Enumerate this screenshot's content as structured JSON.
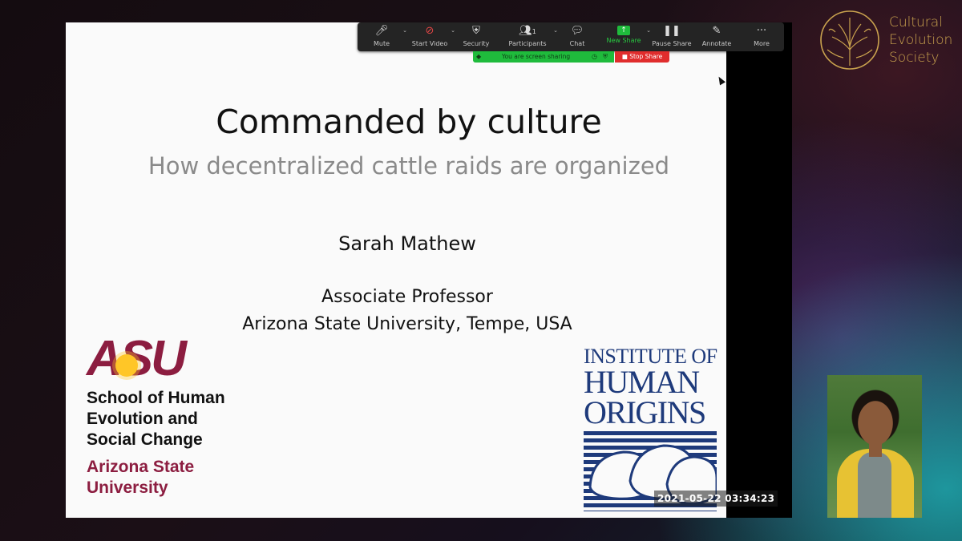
{
  "slide": {
    "title": "Commanded by culture",
    "subtitle": "How decentralized cattle raids are organized",
    "author": "Sarah Mathew",
    "role": "Associate Professor",
    "affiliation": "Arizona State University, Tempe, USA",
    "asu": {
      "logo_text": "ASU",
      "school_lines": [
        "School of Human",
        "Evolution and",
        "Social Change"
      ],
      "university_lines": [
        "Arizona State",
        "University"
      ],
      "colors": {
        "maroon": "#8c1d40",
        "gold": "#ffc627"
      }
    },
    "iho": {
      "lines": [
        "INSTITUTE OF",
        "HUMAN",
        "ORIGINS"
      ],
      "color": "#1e3a7b"
    }
  },
  "toolbar": {
    "items": [
      {
        "label": "Mute",
        "icon": "microphone-icon",
        "has_caret": true
      },
      {
        "label": "Start Video",
        "icon": "video-off-icon",
        "has_caret": true
      },
      {
        "label": "Security",
        "icon": "shield-icon",
        "has_caret": false
      },
      {
        "label": "Participants",
        "icon": "participants-icon",
        "count": "1",
        "has_caret": true
      },
      {
        "label": "Chat",
        "icon": "chat-icon",
        "has_caret": false
      },
      {
        "label": "New Share",
        "icon": "share-arrow-icon",
        "has_caret": true
      },
      {
        "label": "Pause Share",
        "icon": "pause-icon",
        "has_caret": false
      },
      {
        "label": "Annotate",
        "icon": "pencil-icon",
        "has_caret": false
      },
      {
        "label": "More",
        "icon": "more-icon",
        "has_caret": false
      }
    ],
    "colors": {
      "background": "#242424",
      "green": "#28c840"
    }
  },
  "share_status": {
    "message": "You are screen sharing",
    "stop_label": "Stop Share",
    "colors": {
      "bar": "#1fbb3c",
      "stop": "#e02d2d"
    }
  },
  "timestamp": "2021-05-22  03:34:23",
  "society": {
    "lines": [
      "Cultural",
      "Evolution",
      "Society"
    ],
    "color": "#c9a24e"
  }
}
